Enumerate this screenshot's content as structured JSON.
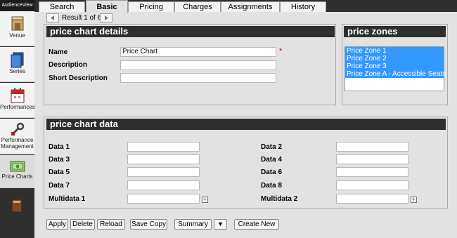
{
  "app": {
    "brand": "AudienceView"
  },
  "sidebar": {
    "items": [
      {
        "label": "Venue",
        "icon": "venue-icon"
      },
      {
        "label": "Series",
        "icon": "series-icon"
      },
      {
        "label": "Performances",
        "icon": "calendar-icon"
      },
      {
        "label_line1": "Performance",
        "label_line2": "Management",
        "icon": "wrench-icon"
      },
      {
        "label": "Price Charts",
        "icon": "price-chart-icon"
      }
    ],
    "extra_icon": "book-icon"
  },
  "tabs": [
    "Search",
    "Basic",
    "Pricing",
    "Charges",
    "Assignments",
    "History"
  ],
  "active_tab": "Basic",
  "result_nav": {
    "text": "Result 1 of 6"
  },
  "details": {
    "title": "price chart details",
    "fields": [
      {
        "label": "Name",
        "value": "Price Chart",
        "required_mark": "*"
      },
      {
        "label": "Description",
        "value": ""
      },
      {
        "label": "Short Description",
        "value": ""
      }
    ]
  },
  "zones": {
    "title": "price zones",
    "options": [
      "Price Zone 1",
      "Price Zone 2",
      "Price Zone 3",
      "Price Zone A - Accessible Seats"
    ],
    "selected_color": "#3399ff"
  },
  "data_panel": {
    "title": "price chart data",
    "left": [
      "Data 1",
      "Data 3",
      "Data 5",
      "Data 7",
      "Multidata 1"
    ],
    "right": [
      "Data 2",
      "Data 4",
      "Data 6",
      "Data 8",
      "Multidata 2"
    ],
    "expand_symbol": "+"
  },
  "actions": {
    "apply": "Apply",
    "delete": "Delete",
    "reload": "Reload",
    "save_copy": "Save Copy",
    "summary": "Summary",
    "summary_dropdown": "▼",
    "create_new": "Create New"
  }
}
